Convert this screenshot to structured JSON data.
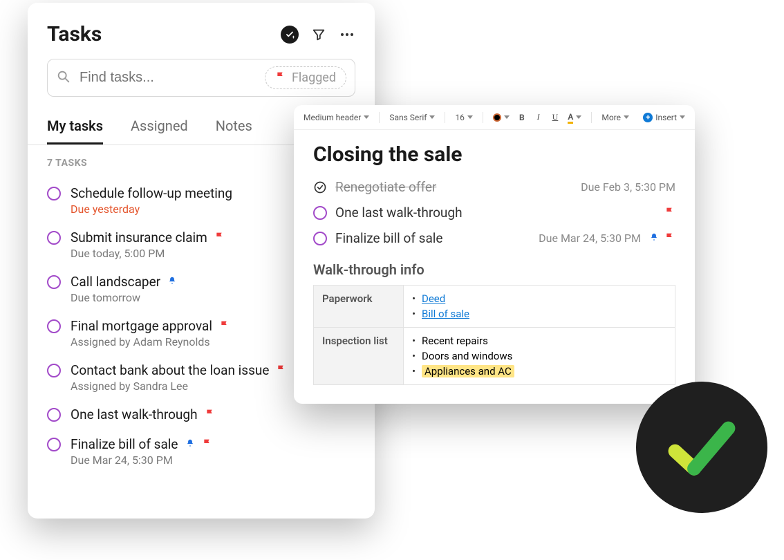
{
  "tasksPanel": {
    "title": "Tasks",
    "search": {
      "placeholder": "Find tasks...",
      "flaggedChip": "Flagged"
    },
    "tabs": {
      "myTasks": "My tasks",
      "assigned": "Assigned",
      "notes": "Notes"
    },
    "countLabel": "7 TASKS",
    "items": [
      {
        "title": "Schedule follow-up meeting",
        "sub": "Due yesterday",
        "subClass": "overdue",
        "flag": false,
        "bell": false
      },
      {
        "title": "Submit insurance claim",
        "sub": "Due today, 5:00 PM",
        "subClass": "",
        "flag": true,
        "bell": false
      },
      {
        "title": "Call landscaper",
        "sub": "Due tomorrow",
        "subClass": "",
        "flag": false,
        "bell": true
      },
      {
        "title": "Final mortgage approval",
        "sub": "Assigned by Adam Reynolds",
        "subClass": "",
        "flag": true,
        "bell": false
      },
      {
        "title": "Contact bank about the loan issue",
        "sub": "Assigned by Sandra Lee",
        "subClass": "",
        "flag": true,
        "bell": false
      },
      {
        "title": "One last walk-through",
        "sub": "",
        "subClass": "",
        "flag": true,
        "bell": false
      },
      {
        "title": "Finalize bill of sale",
        "sub": "Due Mar 24, 5:30 PM",
        "subClass": "",
        "flag": true,
        "bell": true
      }
    ]
  },
  "editor": {
    "toolbar": {
      "headerStyle": "Medium header",
      "font": "Sans Serif",
      "size": "16",
      "bold": "B",
      "italic": "I",
      "underline": "U",
      "highlight": "A",
      "more": "More",
      "insert": "Insert"
    },
    "docTitle": "Closing the sale",
    "tasks": [
      {
        "title": "Renegotiate offer",
        "done": true,
        "due": "Due Feb 3, 5:30 PM",
        "flag": false,
        "bell": false
      },
      {
        "title": "One last walk-through",
        "done": false,
        "due": "",
        "flag": true,
        "bell": false
      },
      {
        "title": "Finalize bill of sale",
        "done": false,
        "due": "Due Mar 24, 5:30 PM",
        "flag": true,
        "bell": true
      }
    ],
    "sectionHeading": "Walk-through info",
    "table": {
      "rows": [
        {
          "label": "Paperwork",
          "items": [
            {
              "text": "Deed",
              "link": true
            },
            {
              "text": "Bill of sale",
              "link": true
            }
          ]
        },
        {
          "label": "Inspection list",
          "items": [
            {
              "text": "Recent repairs"
            },
            {
              "text": "Doors and windows"
            },
            {
              "text": "Appliances and AC",
              "highlight": true
            }
          ]
        }
      ]
    }
  },
  "colors": {
    "flag": "#ef3b3b",
    "bell": "#1f6fe0",
    "checkboxRing": "#a24ac9",
    "link": "#0f7ad6",
    "highlight": "#ffe586"
  }
}
